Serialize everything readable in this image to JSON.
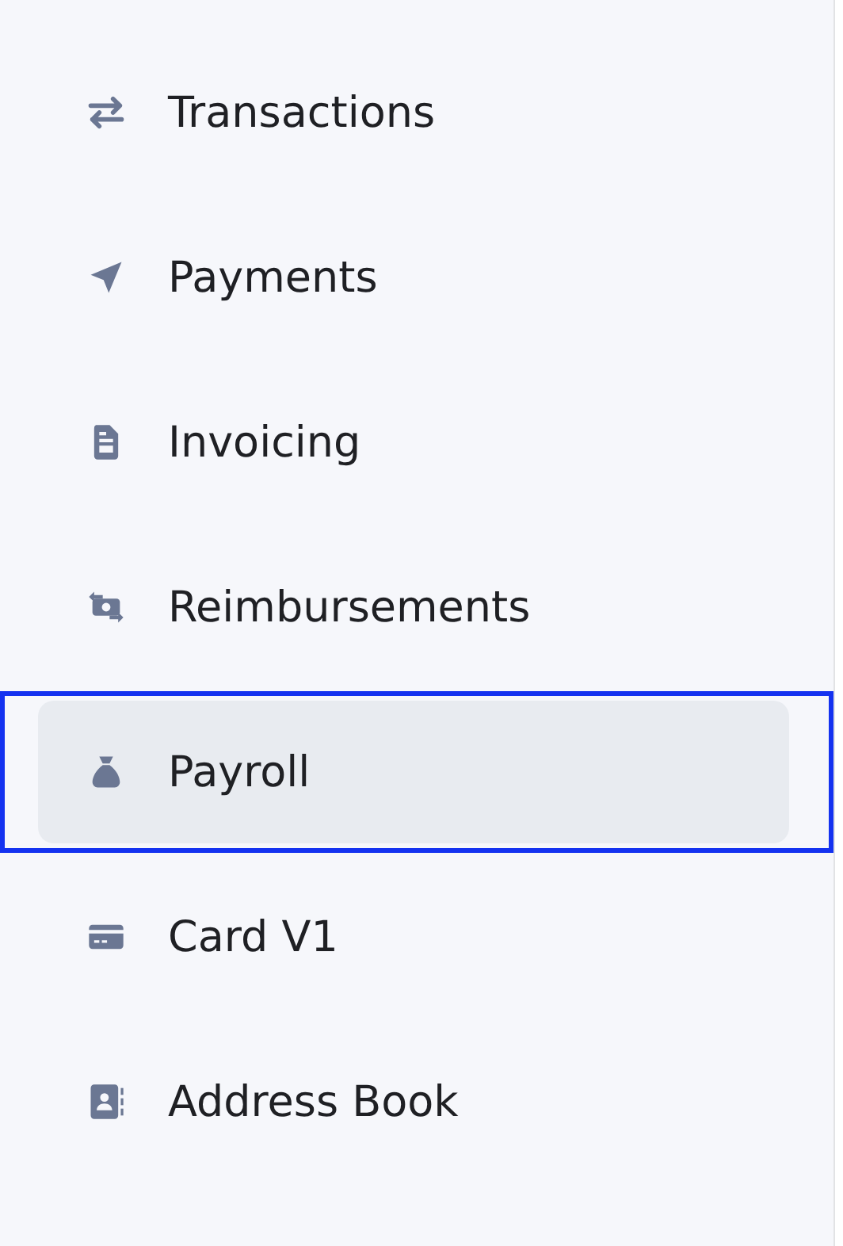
{
  "sidebar": {
    "items": [
      {
        "label": "Transactions",
        "selected": false,
        "highlighted": false
      },
      {
        "label": "Payments",
        "selected": false,
        "highlighted": false
      },
      {
        "label": "Invoicing",
        "selected": false,
        "highlighted": false
      },
      {
        "label": "Reimbursements",
        "selected": false,
        "highlighted": false
      },
      {
        "label": "Payroll",
        "selected": true,
        "highlighted": true
      },
      {
        "label": "Card V1",
        "selected": false,
        "highlighted": false
      },
      {
        "label": "Address Book",
        "selected": false,
        "highlighted": false
      }
    ]
  }
}
